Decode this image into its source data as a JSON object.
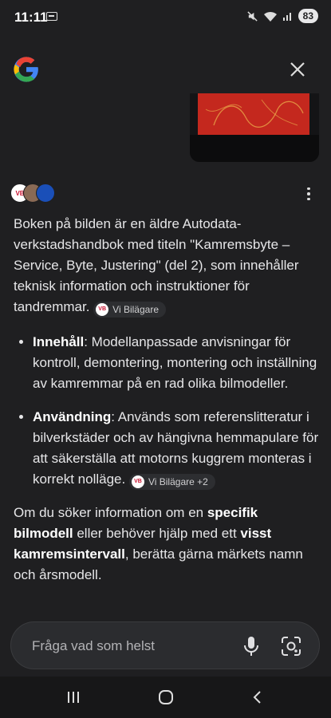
{
  "status_bar": {
    "time": "11:11",
    "battery": "83"
  },
  "header": {
    "logo": "google-g-icon",
    "close_icon": "close-icon"
  },
  "sources_icons": [
    "VB",
    "",
    ""
  ],
  "answer": {
    "intro": "Boken på bilden är en äldre Autodata-verkstadshandbok med titeln \"Kamremsbyte – Service, Byte, Justering\" (del 2), som innehåller teknisk information och instruktioner för tandremmar.",
    "intro_chip": {
      "label": "Vi Bilägare",
      "logo": "VB"
    },
    "bullets": [
      {
        "term": "Innehåll",
        "text": ": Modellanpassade anvisningar för kontroll, demontering, montering och inställning av kamremmar på en rad olika bilmodeller."
      },
      {
        "term": "Användning",
        "text": ": Används som referenslitteratur i bilverkstäder och av hängivna hemmapulare för att säkerställa att motorns kuggrem monteras i korrekt nolläge.",
        "chip": {
          "label": "Vi Bilägare +2",
          "logo": "VB"
        }
      }
    ],
    "closing": {
      "t1": "Om du söker information om en ",
      "b1": "specifik bilmodell",
      "t2": " eller behöver hjälp med ett ",
      "b2": "visst kamremsintervall",
      "t3": ", berätta gärna märkets namn och årsmodell."
    }
  },
  "input": {
    "placeholder": "Fråga vad som helst"
  },
  "colors": {
    "background": "#1f1f21",
    "input_bg": "#2b2c2f",
    "chip_bg": "#2d2e31"
  }
}
